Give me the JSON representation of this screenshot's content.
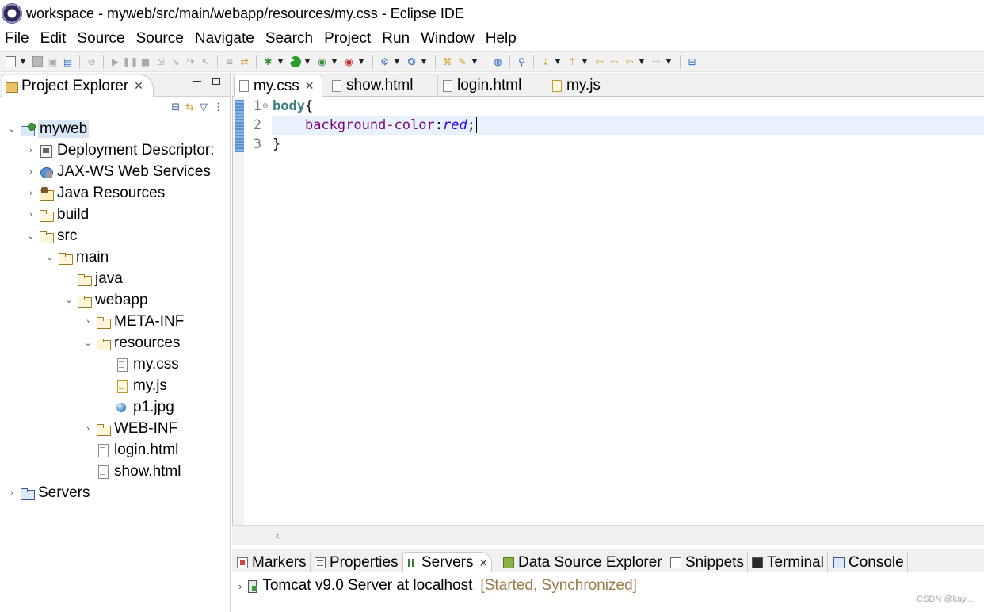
{
  "window": {
    "title": "workspace - myweb/src/main/webapp/resources/my.css - Eclipse IDE"
  },
  "menu": {
    "items": [
      {
        "label": "File",
        "mnemonic": "F",
        "rest": "ile"
      },
      {
        "label": "Edit",
        "mnemonic": "E",
        "rest": "dit"
      },
      {
        "label": "Source",
        "mnemonic": "S",
        "rest": "ource"
      },
      {
        "label": "Source",
        "mnemonic": "S",
        "rest": "ource"
      },
      {
        "label": "Navigate",
        "mnemonic": "N",
        "rest": "avigate"
      },
      {
        "label": "Search",
        "mnemonic": "a",
        "pre": "Se",
        "rest": "rch"
      },
      {
        "label": "Project",
        "mnemonic": "P",
        "rest": "roject"
      },
      {
        "label": "Run",
        "mnemonic": "R",
        "rest": "un"
      },
      {
        "label": "Window",
        "mnemonic": "W",
        "rest": "indow"
      },
      {
        "label": "Help",
        "mnemonic": "H",
        "rest": "elp"
      }
    ]
  },
  "project_explorer": {
    "tab_label": "Project Explorer",
    "tree": [
      {
        "label": "myweb",
        "icon": "project-icon"
      },
      {
        "label": "Deployment Descriptor:",
        "icon": "deployment-descriptor-icon"
      },
      {
        "label": "JAX-WS Web Services",
        "icon": "web-services-icon"
      },
      {
        "label": "Java Resources",
        "icon": "java-resources-icon"
      },
      {
        "label": "build",
        "icon": "folder-icon"
      },
      {
        "label": "src",
        "icon": "folder-icon"
      },
      {
        "label": "main",
        "icon": "folder-icon"
      },
      {
        "label": "java",
        "icon": "folder-icon"
      },
      {
        "label": "webapp",
        "icon": "folder-icon"
      },
      {
        "label": "META-INF",
        "icon": "folder-icon"
      },
      {
        "label": "resources",
        "icon": "folder-icon"
      },
      {
        "label": "my.css",
        "icon": "css-file-icon"
      },
      {
        "label": "my.js",
        "icon": "js-file-icon"
      },
      {
        "label": "p1.jpg",
        "icon": "image-file-icon"
      },
      {
        "label": "WEB-INF",
        "icon": "folder-icon"
      },
      {
        "label": "login.html",
        "icon": "html-file-icon"
      },
      {
        "label": "show.html",
        "icon": "html-file-icon"
      },
      {
        "label": "Servers",
        "icon": "servers-folder-icon"
      }
    ]
  },
  "editor": {
    "tabs": [
      {
        "label": "my.css",
        "active": true
      },
      {
        "label": "show.html",
        "active": false
      },
      {
        "label": "login.html",
        "active": false
      },
      {
        "label": "my.js",
        "active": false
      }
    ],
    "line_numbers": [
      "1",
      "2",
      "3"
    ],
    "code": {
      "line1_selector": "body",
      "line1_brace": "{",
      "line2_indent": "    ",
      "line2_property": "background-color",
      "line2_colon": ":",
      "line2_value": "red",
      "line2_semicolon": ";",
      "line3_brace": "}"
    }
  },
  "bottom_panel": {
    "tabs": [
      {
        "label": "Markers"
      },
      {
        "label": "Properties"
      },
      {
        "label": "Servers",
        "active": true
      },
      {
        "label": "Data Source Explorer"
      },
      {
        "label": "Snippets"
      },
      {
        "label": "Terminal"
      },
      {
        "label": "Console"
      }
    ],
    "server": {
      "name": "Tomcat v9.0 Server at localhost",
      "status": "[Started, Synchronized]"
    }
  },
  "watermark": "CSDN @kay..."
}
